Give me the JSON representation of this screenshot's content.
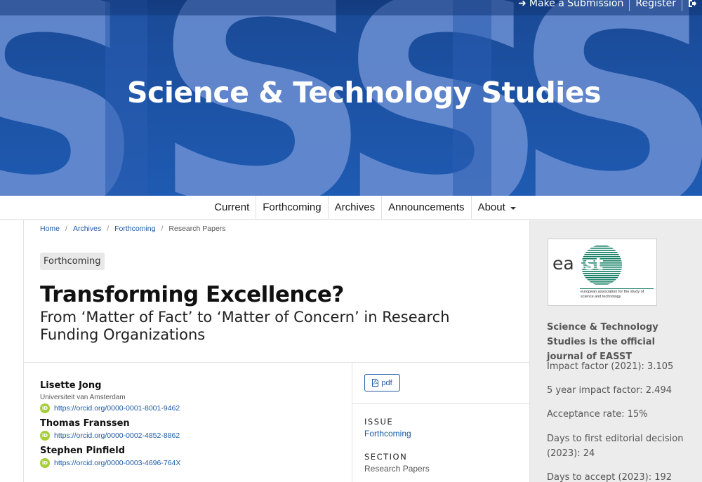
{
  "header": {
    "site_title": "Science & Technology Studies",
    "user_nav": [
      {
        "label": "Make a Submission",
        "icon": "arrow-right-icon"
      },
      {
        "label": "Register"
      }
    ],
    "logout_icon": "logout-icon",
    "background_colors": {
      "base": "#1d56ad",
      "letters": "#6b8fd4"
    }
  },
  "primary_nav": {
    "items": [
      "Current",
      "Forthcoming",
      "Archives",
      "Announcements",
      "About"
    ]
  },
  "breadcrumb": [
    "Home",
    "Archives",
    "Forthcoming",
    "Research Papers"
  ],
  "article": {
    "badge": "Forthcoming",
    "title": "Transforming Excellence?",
    "subtitle": "From ‘Matter of Fact’ to ‘Matter of Concern’ in Research Funding Organizations",
    "authors": [
      {
        "name": "Lisette Jong",
        "affiliation": "Universiteit van Amsterdam",
        "orcid": "https://orcid.org/0000-0001-8001-9462"
      },
      {
        "name": "Thomas Franssen",
        "affiliation": "",
        "orcid": "https://orcid.org/0000-0002-4852-8862"
      },
      {
        "name": "Stephen Pinfield",
        "affiliation": "",
        "orcid": "https://orcid.org/0000-0003-4696-764X"
      }
    ],
    "galley": {
      "label": "pdf",
      "icon": "file-pdf-icon"
    },
    "issue": {
      "label": "ISSUE",
      "value": "Forthcoming"
    },
    "section": {
      "label": "SECTION",
      "value": "Research Papers"
    }
  },
  "sidebar": {
    "logo": {
      "word_left": "ea",
      "word_right": "sst",
      "tagline": "european association for the study of science and technology"
    },
    "official_journal": "Science & Technology Studies is the official journal of EASST",
    "metrics": [
      "Impact factor (2021): 3.105",
      "5 year impact factor: 2.494",
      "Acceptance rate: 15%",
      "Days to first editorial decision (2023): 24",
      "Days to accept (2023): 192"
    ]
  },
  "colors": {
    "link": "#1e5aa5",
    "orcid": "#a6ce39",
    "sidebar_bg": "#ececec",
    "easst_green": "#0d7a5f"
  }
}
